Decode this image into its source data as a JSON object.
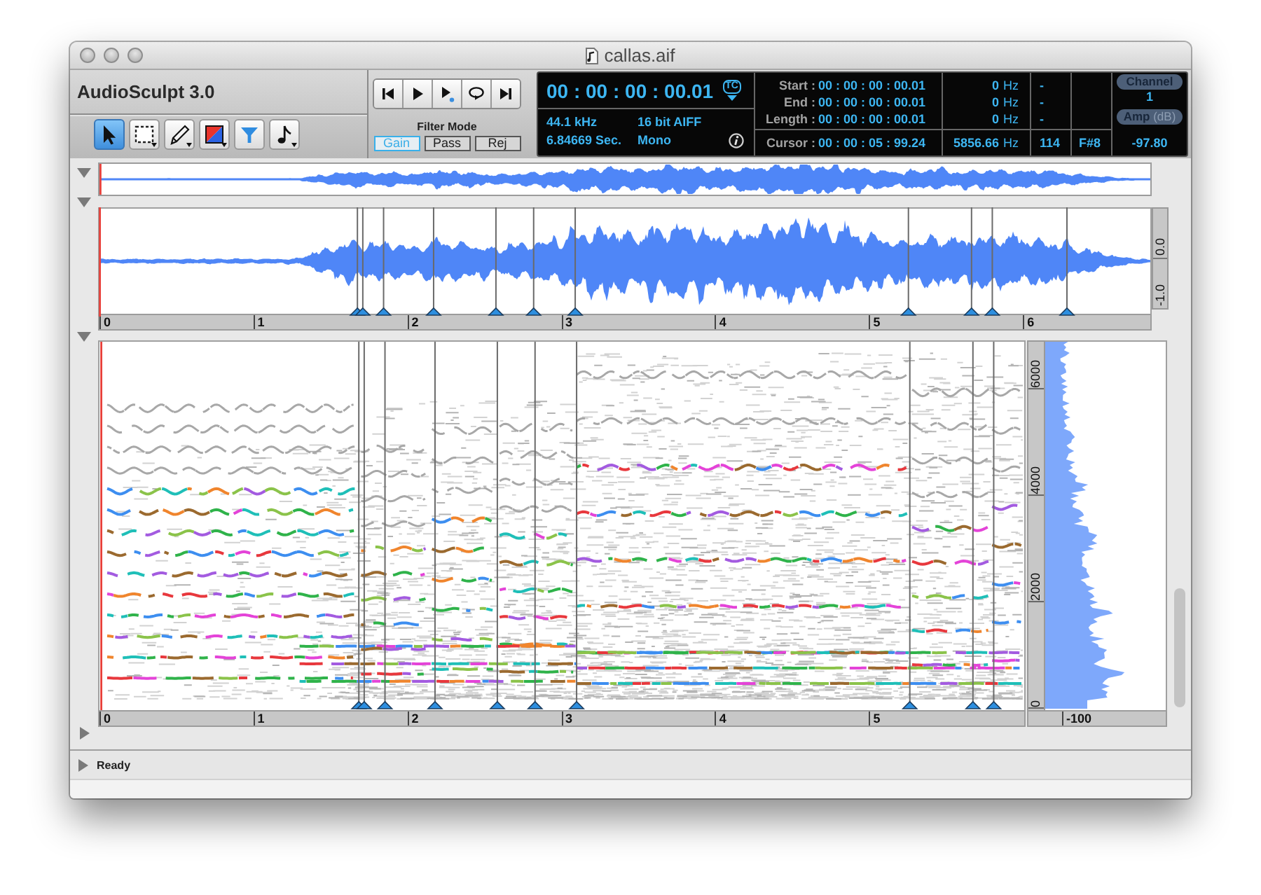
{
  "window": {
    "title": "callas.aif"
  },
  "toolbar": {
    "app_name": "AudioSculpt 3.0",
    "tools": [
      {
        "kind": "pointer",
        "selected": true
      },
      {
        "kind": "marquee",
        "selected": false
      },
      {
        "kind": "pencil",
        "selected": false
      },
      {
        "kind": "color",
        "selected": false
      },
      {
        "kind": "filter",
        "selected": false
      },
      {
        "kind": "note",
        "selected": false
      }
    ]
  },
  "transport": {
    "buttons": [
      {
        "kind": "to_start"
      },
      {
        "kind": "play"
      },
      {
        "kind": "play_cursor"
      },
      {
        "kind": "loop"
      },
      {
        "kind": "to_end"
      }
    ],
    "filter_mode": {
      "label": "Filter Mode",
      "options": [
        {
          "label": "Gain",
          "selected": true
        },
        {
          "label": "Pass",
          "selected": false
        },
        {
          "label": "Rej",
          "selected": false
        }
      ]
    }
  },
  "display": {
    "time": "00 : 00 : 00 : 00.01",
    "time_format": "TC",
    "sample_rate": "44.1 kHz",
    "bit_format": "16 bit AIFF",
    "duration": "6.84669 Sec.",
    "channel_mode": "Mono",
    "rows": [
      {
        "label": "Start :",
        "time": "00 : 00 : 00 : 00.01",
        "frequency": "0",
        "unit": "Hz",
        "midi": "-"
      },
      {
        "label": "End :",
        "time": "00 : 00 : 00 : 00.01",
        "frequency": "0",
        "unit": "Hz",
        "midi": "-"
      },
      {
        "label": "Length :",
        "time": "00 : 00 : 00 : 00.01",
        "frequency": "0",
        "unit": "Hz",
        "midi": "-"
      }
    ],
    "cursor": {
      "label": "Cursor :",
      "time": "00 : 00 : 05 : 99.24",
      "frequency": "5856.66",
      "unit": "Hz",
      "midi": "114",
      "note": "F#8"
    },
    "channel": {
      "label": "Channel",
      "value": "1"
    },
    "amplitude": {
      "label": "Amp",
      "unit": "(dB)",
      "value": "-97.80"
    }
  },
  "overview": {
    "expanded": true
  },
  "waveform": {
    "expanded": true,
    "amplitude_labels": [
      "0.0",
      "-1.0"
    ],
    "ruler": [
      "0",
      "1",
      "2",
      "3",
      "4",
      "5",
      "6"
    ]
  },
  "spectrogram": {
    "expanded": true,
    "ruler": [
      "0",
      "1",
      "2",
      "3",
      "4",
      "5"
    ],
    "frequency_labels": [
      "6000",
      "4000",
      "2000",
      "0"
    ],
    "spectrum_ruler": [
      "-100"
    ]
  },
  "panel_4": {
    "expanded": false
  },
  "status_bar": {
    "expanded": false,
    "text": "Ready"
  }
}
